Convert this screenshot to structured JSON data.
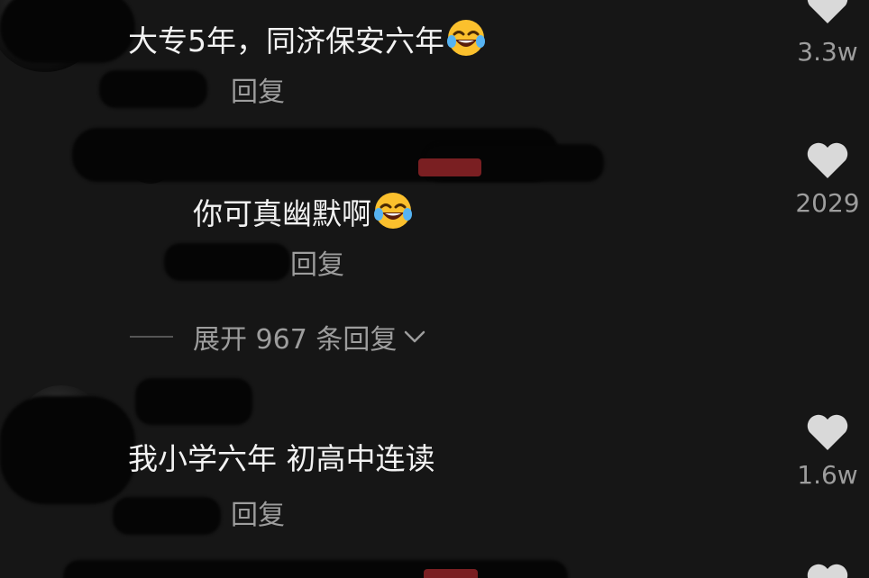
{
  "comments": [
    {
      "text": "大专5年，同济保安六年",
      "emoji": "rofl-emoji",
      "reply_label": "回复",
      "likes": "3.3w"
    },
    {
      "text": "你可真幽默啊",
      "emoji": "rofl-emoji",
      "reply_label": "回复",
      "likes": "2029"
    },
    {
      "text": "我小学六年 初高中连读",
      "reply_label": "回复",
      "likes": "1.6w"
    }
  ],
  "expand": {
    "label": "展开 967 条回复"
  },
  "colors": {
    "background": "#161616",
    "heart": "#d9d9d9",
    "muted": "#9d9d9d",
    "badge": "#7a1f22"
  },
  "icons": [
    "heart-icon",
    "chevron-down-icon",
    "rofl-emoji"
  ]
}
